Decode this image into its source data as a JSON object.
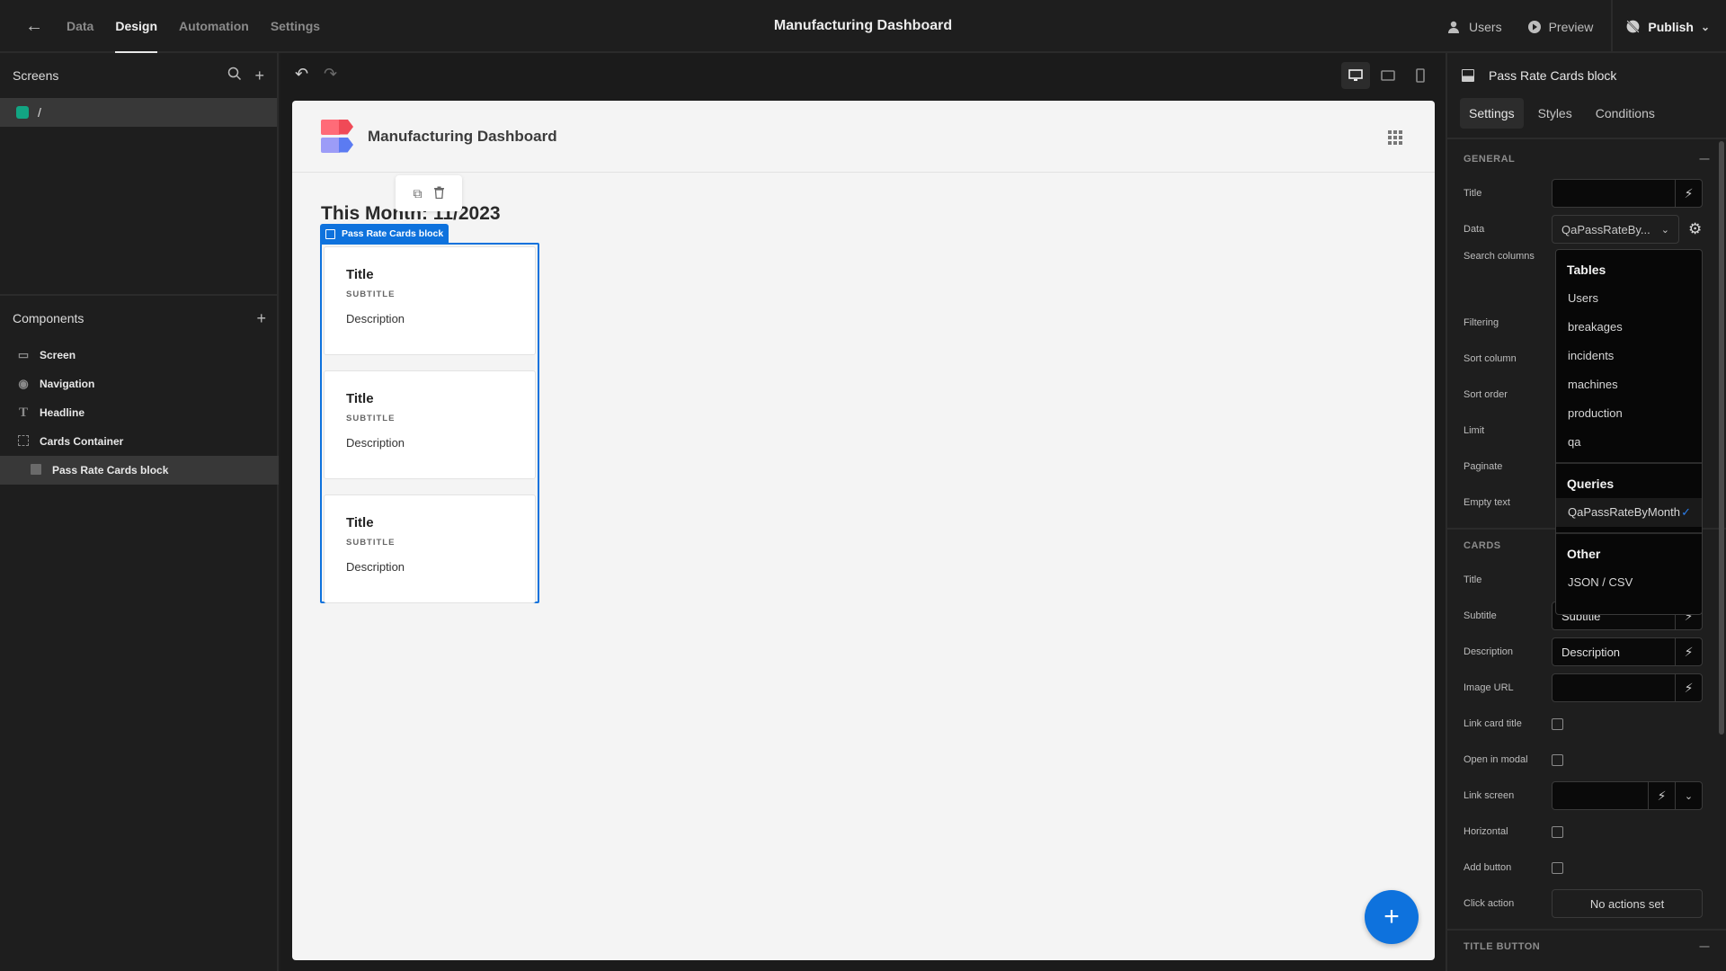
{
  "topbar": {
    "back_icon": "arrow-left-icon",
    "tabs": [
      {
        "label": "Data",
        "active": false
      },
      {
        "label": "Design",
        "active": true
      },
      {
        "label": "Automation",
        "active": false
      },
      {
        "label": "Settings",
        "active": false
      }
    ],
    "app_title": "Manufacturing Dashboard",
    "users_label": "Users",
    "preview_label": "Preview",
    "publish_label": "Publish"
  },
  "left_panel": {
    "screens_title": "Screens",
    "screens": [
      {
        "label": "/",
        "color": "#12a583"
      }
    ],
    "components_title": "Components",
    "components": [
      {
        "label": "Screen",
        "icon": "screen-icon",
        "child": false
      },
      {
        "label": "Navigation",
        "icon": "eye-icon",
        "child": false
      },
      {
        "label": "Headline",
        "icon": "text-icon",
        "child": false
      },
      {
        "label": "Cards Container",
        "icon": "container-icon",
        "child": false
      },
      {
        "label": "Pass Rate Cards block",
        "icon": "cards-block-icon",
        "child": true,
        "selected": true
      }
    ]
  },
  "canvas": {
    "app_name": "Manufacturing Dashboard",
    "headline": "This Month: 11/2023",
    "block_label": "Pass Rate Cards block",
    "cards": [
      {
        "title": "Title",
        "subtitle": "SUBTITLE",
        "description": "Description"
      },
      {
        "title": "Title",
        "subtitle": "SUBTITLE",
        "description": "Description"
      },
      {
        "title": "Title",
        "subtitle": "SUBTITLE",
        "description": "Description"
      }
    ],
    "accent": "#0e72dd"
  },
  "right_panel": {
    "component_name": "Pass Rate Cards block",
    "tabs": [
      {
        "label": "Settings",
        "active": true
      },
      {
        "label": "Styles",
        "active": false
      },
      {
        "label": "Conditions",
        "active": false
      }
    ],
    "general": {
      "section": "GENERAL",
      "title_label": "Title",
      "title_value": "",
      "data_label": "Data",
      "data_value": "QaPassRateBy...",
      "search_columns_label": "Search columns",
      "filtering_label": "Filtering",
      "sort_column_label": "Sort column",
      "sort_order_label": "Sort order",
      "limit_label": "Limit",
      "paginate_label": "Paginate",
      "empty_text_label": "Empty text"
    },
    "dropdown": {
      "tables_heading": "Tables",
      "tables": [
        "Users",
        "breakages",
        "incidents",
        "machines",
        "production",
        "qa"
      ],
      "queries_heading": "Queries",
      "queries": [
        {
          "label": "QaPassRateByMonth",
          "selected": true
        }
      ],
      "other_heading": "Other",
      "other": [
        "JSON / CSV"
      ]
    },
    "cards": {
      "section": "CARDS",
      "title_label": "Title",
      "subtitle_label": "Subtitle",
      "subtitle_value": "Subtitle",
      "description_label": "Description",
      "description_value": "Description",
      "image_url_label": "Image URL",
      "image_url_value": "",
      "link_card_title_label": "Link card title",
      "link_card_title_checked": false,
      "open_in_modal_label": "Open in modal",
      "open_in_modal_checked": false,
      "link_screen_label": "Link screen",
      "link_screen_value": "",
      "horizontal_label": "Horizontal",
      "horizontal_checked": false,
      "add_button_label": "Add button",
      "add_button_checked": false,
      "click_action_label": "Click action",
      "click_action_value": "No actions set"
    },
    "title_button_section": "TITLE BUTTON"
  }
}
